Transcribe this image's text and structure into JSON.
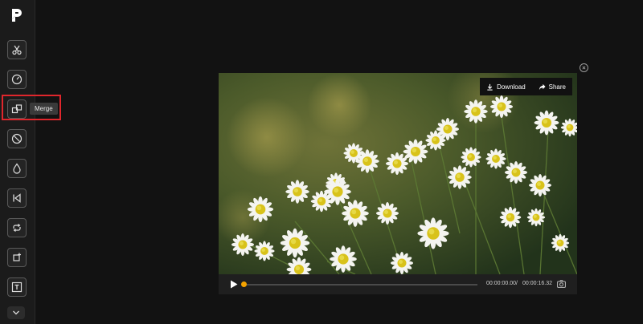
{
  "app": {
    "logo_icon": "app-logo-icon"
  },
  "sidebar": {
    "items": [
      {
        "id": "cut",
        "icon": "scissors-icon"
      },
      {
        "id": "speed",
        "icon": "speedometer-icon"
      },
      {
        "id": "merge",
        "icon": "merge-icon",
        "tooltip": "Merge",
        "highlighted": true
      },
      {
        "id": "rotate",
        "icon": "rotate-icon"
      },
      {
        "id": "watermark",
        "icon": "drop-icon"
      },
      {
        "id": "reverse",
        "icon": "reverse-icon"
      },
      {
        "id": "loop",
        "icon": "loop-icon"
      },
      {
        "id": "crop",
        "icon": "crop-icon"
      },
      {
        "id": "text",
        "icon": "text-icon"
      },
      {
        "id": "more",
        "icon": "chevron-down-icon"
      }
    ]
  },
  "player": {
    "close_icon": "close-icon",
    "actions": {
      "download_label": "Download",
      "share_label": "Share"
    },
    "controls": {
      "current_time": "00:00:00.00",
      "separator": "/",
      "duration": "00:00:16.32",
      "progress": 0.0
    }
  },
  "colors": {
    "accent": "#f5a300",
    "highlight": "#e0262c",
    "background": "#121212"
  }
}
